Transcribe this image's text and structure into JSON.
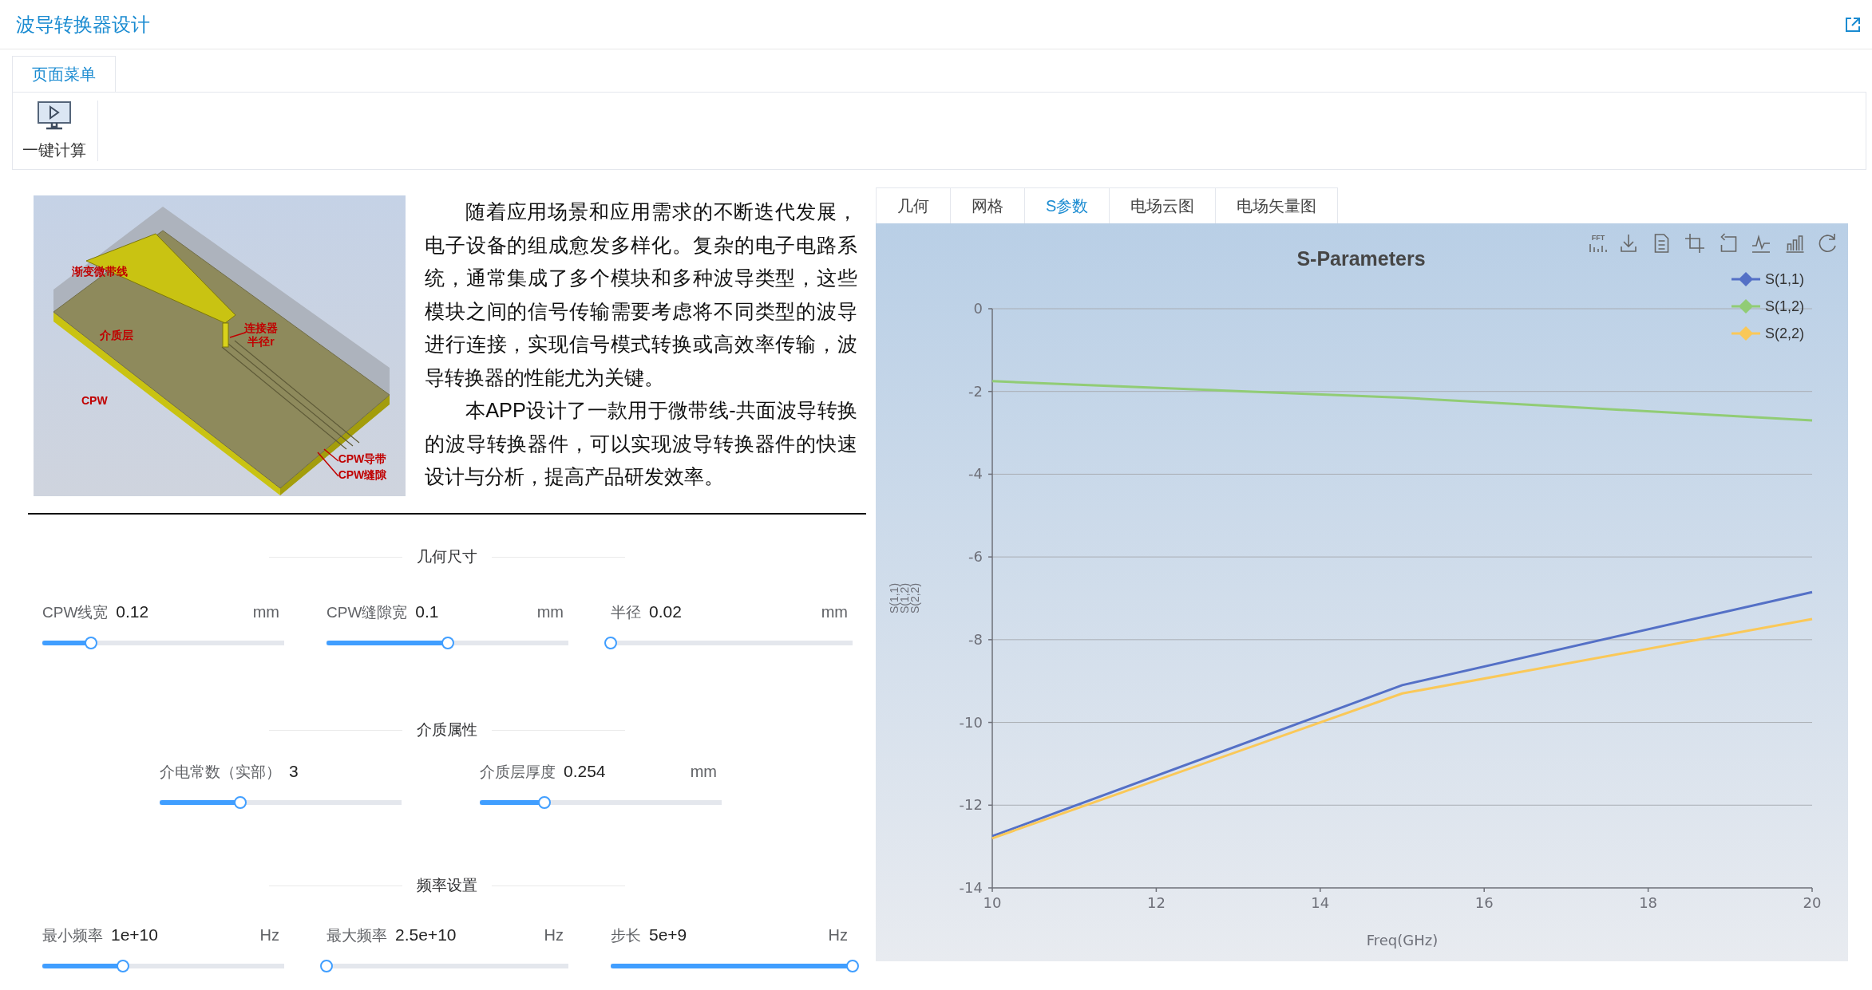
{
  "header": {
    "title": "波导转换器设计"
  },
  "menu": {
    "tabs": [
      {
        "label": "页面菜单",
        "selected": true
      }
    ],
    "tools": [
      {
        "label": "一键计算"
      }
    ]
  },
  "intro": {
    "diagram_labels": [
      "渐变微带线",
      "介质层",
      "连接器",
      "半径r",
      "CPW",
      "CPW导带",
      "CPW缝隙"
    ],
    "paragraphs": [
      "随着应用场景和应用需求的不断迭代发展，电子设备的组成愈发多样化。复杂的电子电路系统，通常集成了多个模块和多种波导类型，这些模块之间的信号传输需要考虑将不同类型的波导进行连接，实现信号模式转换或高效率传输，波导转换器的性能尤为关键。",
      "本APP设计了一款用于微带线-共面波导转换的波导转换器件，可以实现波导转换器件的快速设计与分析，提高产品研发效率。"
    ]
  },
  "sections": [
    {
      "title": "几何尺寸",
      "params": [
        {
          "label": "CPW线宽",
          "value": "0.12",
          "unit": "mm",
          "level": 0.2
        },
        {
          "label": "CPW缝隙宽",
          "value": "0.1",
          "unit": "mm",
          "level": 0.5
        },
        {
          "label": "半径",
          "value": "0.02",
          "unit": "mm",
          "level": 0
        }
      ]
    },
    {
      "title": "介质属性",
      "params": [
        {
          "label": "介电常数（实部）",
          "value": "3",
          "level": 0.333
        },
        {
          "label": "介质层厚度",
          "value": "0.254",
          "unit": "mm",
          "level": 0.266
        }
      ]
    },
    {
      "title": "频率设置",
      "params": [
        {
          "label": "最小频率",
          "value": "1e+10",
          "unit": "Hz",
          "level": 0.333
        },
        {
          "label": "最大频率",
          "value": "2.5e+10",
          "unit": "Hz",
          "level": 0
        },
        {
          "label": "步长",
          "value": "5e+9",
          "unit": "Hz",
          "level": 1
        }
      ]
    }
  ],
  "view_tabs": [
    {
      "label": "几何",
      "selected": false
    },
    {
      "label": "网格",
      "selected": false
    },
    {
      "label": "S参数",
      "selected": true
    },
    {
      "label": "电场云图",
      "selected": false
    },
    {
      "label": "电场矢量图",
      "selected": false
    }
  ],
  "chart": {
    "toolbox_label": "FFT",
    "chart_data": {
      "type": "line",
      "title": "S-Parameters",
      "xlabel": "Freq(GHz)",
      "ylabel": "S(1,1) S(1,2) S(2,2)",
      "x": [
        10,
        15,
        20
      ],
      "series": [
        {
          "name": "S(1,1)",
          "color": "#5470c6",
          "values": [
            -12.75,
            -9.1,
            -6.85
          ]
        },
        {
          "name": "S(1,2)",
          "color": "#91cc75",
          "values": [
            -1.75,
            -2.15,
            -2.7
          ]
        },
        {
          "name": "S(2,2)",
          "color": "#fac858",
          "values": [
            -12.8,
            -9.3,
            -7.5
          ]
        }
      ],
      "grid": true,
      "legend": true,
      "xlim": [
        10,
        20
      ],
      "ylim": [
        -14,
        0
      ],
      "xticks": [
        10,
        12,
        14,
        16,
        18,
        20
      ],
      "yticks": [
        0,
        -2,
        -4,
        -6,
        -8,
        -10,
        -12,
        -14
      ]
    }
  }
}
